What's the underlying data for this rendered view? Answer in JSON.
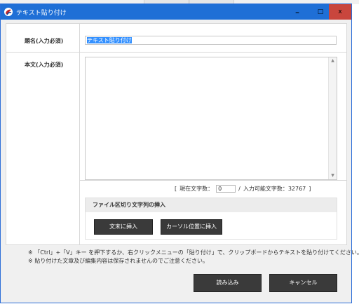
{
  "window": {
    "title": "テキスト貼り付け",
    "minimize_glyph": "‒",
    "maximize_glyph": "□",
    "close_glyph": "x"
  },
  "form": {
    "title_label": "題名(入力必須)",
    "title_value": "テキスト貼り付け",
    "body_label": "本文(入力必須)",
    "body_value": "",
    "scroll_up": "▲",
    "scroll_down": "▼"
  },
  "counter": {
    "open_bracket": "[",
    "current_label": "現在文字数：",
    "current_value": "0",
    "separator": "/",
    "max_label": "入力可能文字数：32767",
    "close_bracket": "]"
  },
  "insert_group": {
    "title": "ファイル区切り文字列の挿入",
    "end_button": "文末に挿入",
    "cursor_button": "カーソル位置に挿入"
  },
  "notes": [
    "※ 「Ctrl」+「V」キー を押下するか、右クリックメニューの「貼り付け」で、クリップボードからテキストを貼り付けてください。",
    "※ 貼り付けた文章及び編集内容は保存されませんのでご注意ください。"
  ],
  "footer": {
    "load_button": "読み込み",
    "cancel_button": "キャンセル"
  },
  "colors": {
    "titlebar": "#1f6fd6",
    "close": "#c9463d",
    "button_dark": "#3a3a3a"
  }
}
